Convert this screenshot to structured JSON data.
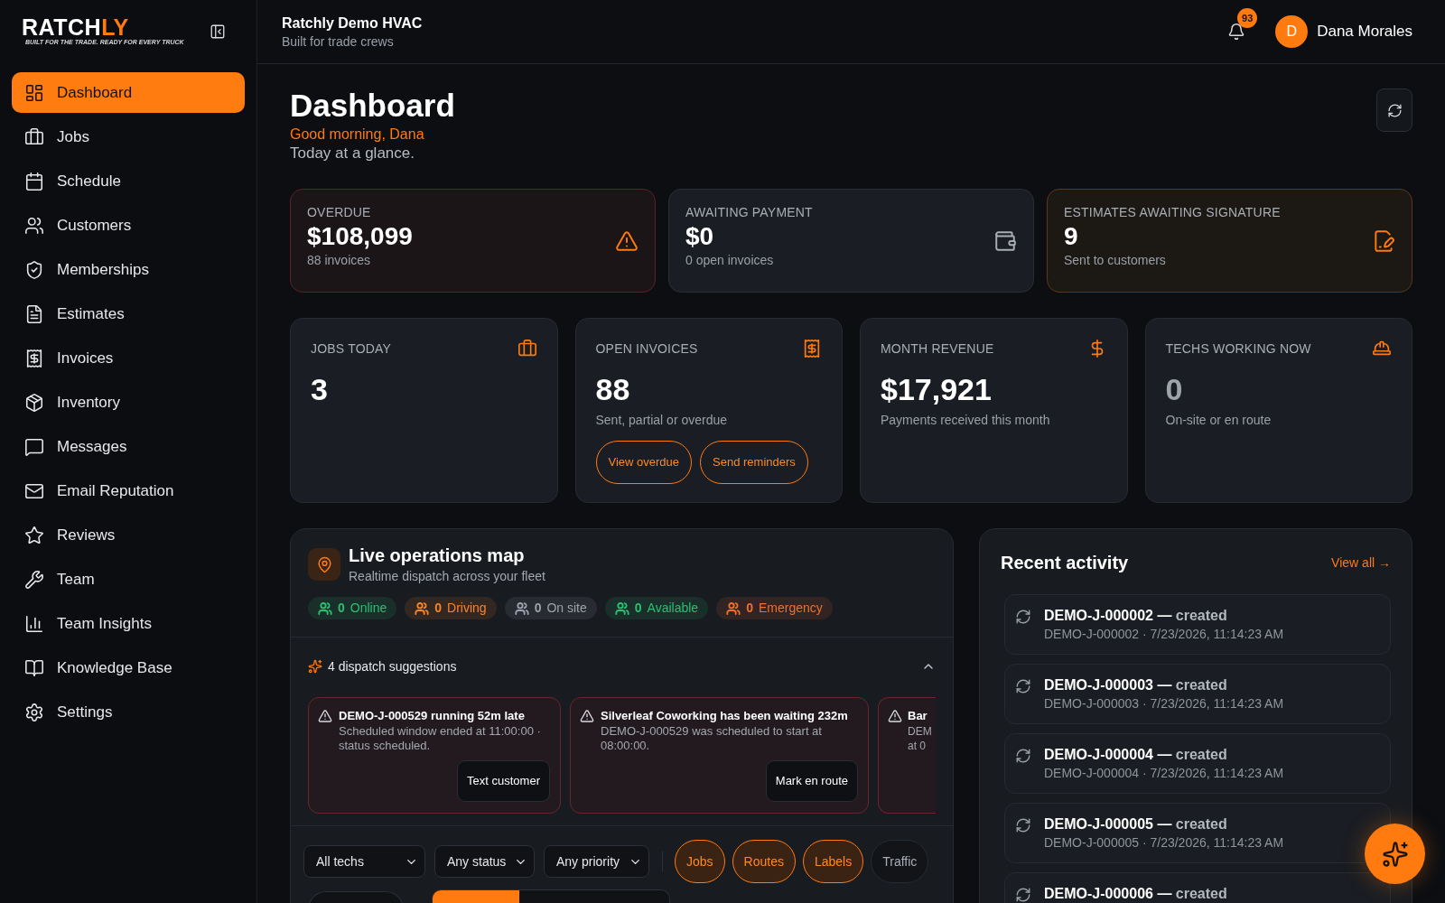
{
  "sidebar": {
    "logo": {
      "name": "RATCH",
      "name_accent": "LY",
      "tagline": "BUILT FOR THE TRADE. READY FOR EVERY TRUCK"
    },
    "items": [
      {
        "label": "Dashboard",
        "selected": true
      },
      {
        "label": "Jobs",
        "selected": false
      },
      {
        "label": "Schedule",
        "selected": false
      },
      {
        "label": "Customers",
        "selected": false
      },
      {
        "label": "Memberships",
        "selected": false
      },
      {
        "label": "Estimates",
        "selected": false
      },
      {
        "label": "Invoices",
        "selected": false
      },
      {
        "label": "Inventory",
        "selected": false
      },
      {
        "label": "Messages",
        "selected": false
      },
      {
        "label": "Email Reputation",
        "selected": false
      },
      {
        "label": "Reviews",
        "selected": false
      },
      {
        "label": "Team",
        "selected": false
      },
      {
        "label": "Team Insights",
        "selected": false
      },
      {
        "label": "Knowledge Base",
        "selected": false
      },
      {
        "label": "Settings",
        "selected": false
      }
    ]
  },
  "header": {
    "org": "Ratchly Demo HVAC",
    "tagline": "Built for trade crews",
    "notifications": "93",
    "user": {
      "initial": "D",
      "name": "Dana Morales"
    }
  },
  "page": {
    "title": "Dashboard",
    "greeting": "Good morning, Dana",
    "subtitle": "Today at a glance."
  },
  "summary_cards": [
    {
      "kind": "alert",
      "label": "OVERDUE",
      "value": "$108,099",
      "note": "88 invoices"
    },
    {
      "kind": "neutral",
      "label": "AWAITING PAYMENT",
      "value": "$0",
      "note": "0 open invoices"
    },
    {
      "kind": "warning",
      "label": "ESTIMATES AWAITING SIGNATURE",
      "value": "9",
      "note": "Sent to customers"
    }
  ],
  "stat_cards": [
    {
      "label": "JOBS TODAY",
      "value": "3",
      "muted": false
    },
    {
      "label": "OPEN INVOICES",
      "value": "88",
      "note": "Sent, partial or overdue",
      "muted": false,
      "actions": [
        "View overdue",
        "Send reminders"
      ]
    },
    {
      "label": "MONTH REVENUE",
      "value": "$17,921",
      "note": "Payments received this month",
      "muted": false
    },
    {
      "label": "TECHS WORKING NOW",
      "value": "0",
      "note": "On-site or en route",
      "muted": true
    }
  ],
  "live_map": {
    "title": "Live operations map",
    "subtitle": "Realtime dispatch across your fleet",
    "chips": [
      {
        "count": "0",
        "label": "Online",
        "color": "#2bbf73"
      },
      {
        "count": "0",
        "label": "Driving",
        "color": "#f5862a"
      },
      {
        "count": "0",
        "label": "On site",
        "color": "#9ca3af"
      },
      {
        "count": "0",
        "label": "Available",
        "color": "#2bbf73"
      },
      {
        "count": "0",
        "label": "Emergency",
        "color": "#ef6f2e"
      }
    ],
    "suggestions": {
      "heading": "4 dispatch suggestions",
      "expanded": true,
      "items": [
        {
          "title": "DEMO-J-000529 running 52m late",
          "body": "Scheduled window ended at 11:00:00 · status scheduled.",
          "action": "Text customer"
        },
        {
          "title": "Silverleaf Coworking has been waiting 232m",
          "body": "DEMO-J-000529 was scheduled to start at 08:00:00.",
          "action": "Mark en route"
        },
        {
          "title": "Bar",
          "body": "DEM at 0"
        }
      ]
    },
    "filters": [
      {
        "value": "All techs"
      },
      {
        "value": "Any status"
      },
      {
        "value": "Any priority"
      }
    ],
    "layers": [
      {
        "label": "Jobs",
        "on": true
      },
      {
        "label": "Routes",
        "on": true
      },
      {
        "label": "Labels",
        "on": true
      },
      {
        "label": "Traffic",
        "on": false
      }
    ]
  },
  "recent_activity": {
    "title": "Recent activity",
    "link": "View all →",
    "items": [
      {
        "title": "DEMO-J-000002 —",
        "event": "created",
        "meta": "DEMO-J-000002 · 7/23/2026, 11:14:23 AM"
      },
      {
        "title": "DEMO-J-000003 —",
        "event": "created",
        "meta": "DEMO-J-000003 · 7/23/2026, 11:14:23 AM"
      },
      {
        "title": "DEMO-J-000004 —",
        "event": "created",
        "meta": "DEMO-J-000004 · 7/23/2026, 11:14:23 AM"
      },
      {
        "title": "DEMO-J-000005 —",
        "event": "created",
        "meta": "DEMO-J-000005 · 7/23/2026, 11:14:23 AM"
      },
      {
        "title": "DEMO-J-000006 —",
        "event": "created"
      }
    ]
  }
}
